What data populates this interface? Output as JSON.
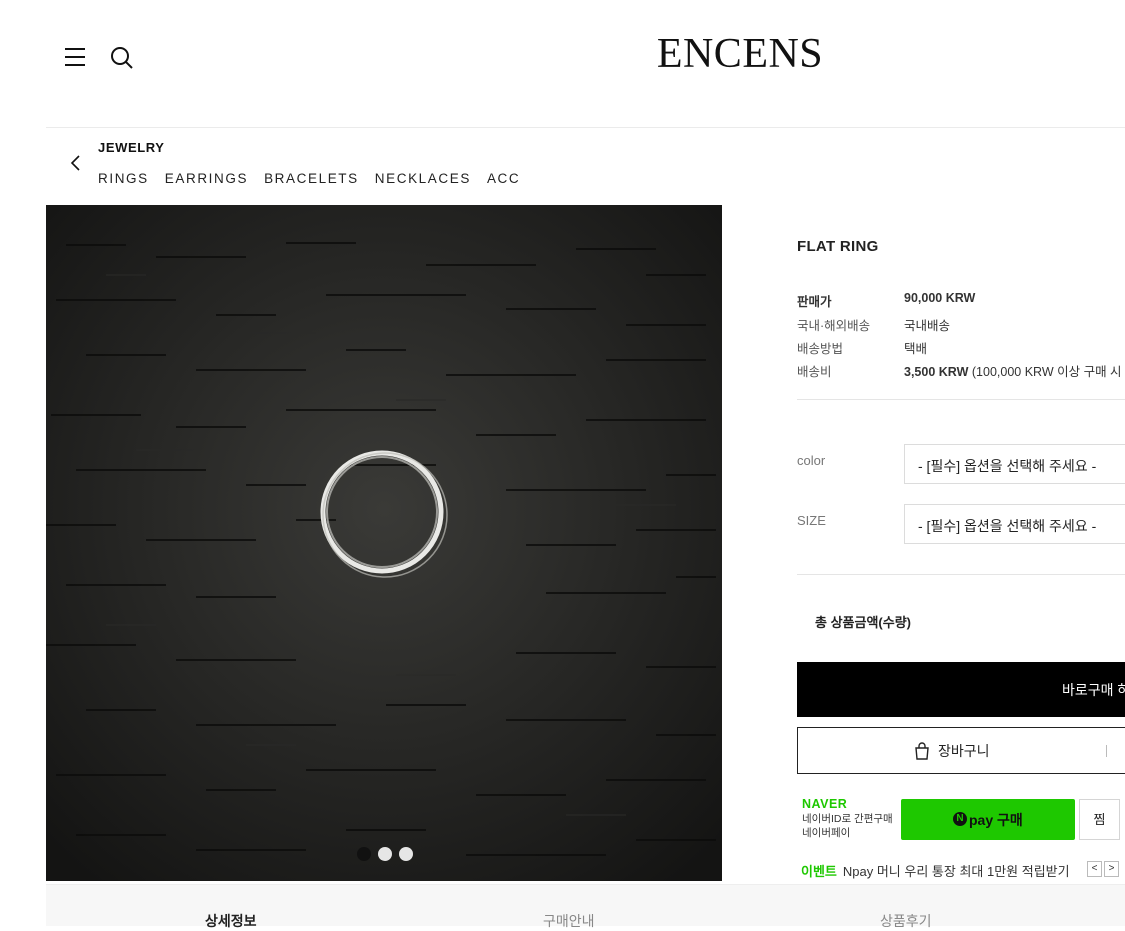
{
  "header": {
    "logo": "ENCENS",
    "menu_icon": "hamburger-menu-icon",
    "search_icon": "search-icon"
  },
  "category": {
    "title": "JEWELRY",
    "back_icon": "chevron-left-icon",
    "items": [
      "RINGS",
      "EARRINGS",
      "BRACELETS",
      "NECKLACES",
      "ACC"
    ]
  },
  "gallery": {
    "dots": 3,
    "active_index": 0
  },
  "product": {
    "name": "FLAT RING",
    "rows": [
      {
        "label": "판매가",
        "value": "90,000 KRW"
      },
      {
        "label": "국내·해외배송",
        "value": "국내배송"
      },
      {
        "label": "배송방법",
        "value": "택배"
      },
      {
        "label": "배송비",
        "value_bold": "3,500 KRW",
        "value_rest": "(100,000 KRW 이상 구매 시"
      }
    ]
  },
  "options": [
    {
      "label": "color",
      "placeholder": "- [필수] 옵션을 선택해 주세요 -"
    },
    {
      "label": "SIZE",
      "placeholder": "- [필수] 옵션을 선택해 주세요 -"
    }
  ],
  "total_label": "총 상품금액(수량)",
  "buttons": {
    "buy_now": "바로구매 하",
    "cart": "장바구니",
    "cart_icon": "shopping-bag-icon"
  },
  "naver": {
    "logo": "NAVER",
    "desc_line1": "네이버ID로 간편구매",
    "desc_line2": "네이버페이",
    "pay_n": "N",
    "pay_label": "pay 구매",
    "zzim": "찜",
    "event_tag": "이벤트",
    "event_text": "Npay 머니 우리 통장 최대 1만원 적립받기",
    "prev_arrow": "<",
    "next_arrow": ">",
    "brand_color": "#1ec800"
  },
  "tabs": [
    "상세정보",
    "구매안내",
    "상품후기"
  ]
}
